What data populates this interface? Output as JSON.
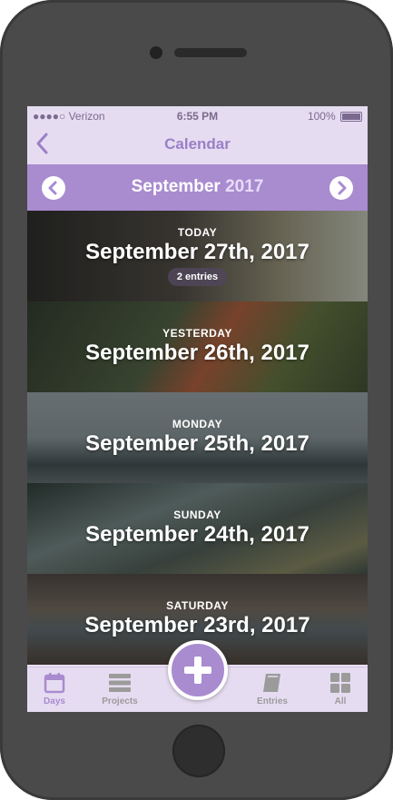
{
  "status_bar": {
    "carrier": "●●●●○ Verizon",
    "time": "6:55 PM",
    "battery": "100%"
  },
  "nav": {
    "title": "Calendar",
    "back_icon": "chevron-left-icon"
  },
  "month": {
    "name": "September",
    "year": "2017",
    "prev_icon": "chevron-left-circle-icon",
    "next_icon": "chevron-right-circle-icon"
  },
  "days": [
    {
      "label": "TODAY",
      "date": "September 27th, 2017",
      "entries": "2 entries",
      "bg": "#3c3a36"
    },
    {
      "label": "YESTERDAY",
      "date": "September 26th, 2017",
      "entries": "",
      "bg": "#3f4a37"
    },
    {
      "label": "MONDAY",
      "date": "September 25th, 2017",
      "entries": "",
      "bg": "#6a7478"
    },
    {
      "label": "SUNDAY",
      "date": "September 24th, 2017",
      "entries": "",
      "bg": "#4f5a55"
    },
    {
      "label": "SATURDAY",
      "date": "September 23rd, 2017",
      "entries": "",
      "bg": "#5a554e"
    }
  ],
  "tabs": [
    {
      "label": "Days",
      "icon": "calendar-icon"
    },
    {
      "label": "Projects",
      "icon": "projects-icon"
    },
    {
      "label": "Entries",
      "icon": "book-icon"
    },
    {
      "label": "All",
      "icon": "grid-icon"
    }
  ],
  "colors": {
    "accent": "#a98bd0",
    "bar_bg": "#e6dcf1",
    "inactive": "#9b9b9b"
  }
}
